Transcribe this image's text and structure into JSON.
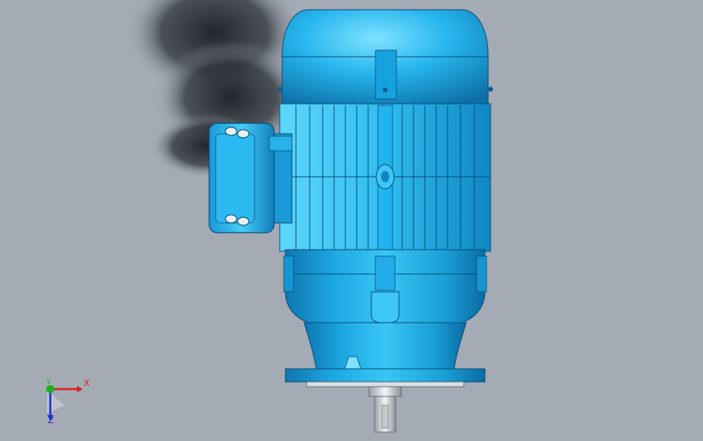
{
  "viewport": {
    "background": "#a4abb5",
    "model_color": "#1aa7e0",
    "model_highlight": "#6fdcff",
    "model_shadow": "#0c6fa6"
  },
  "triad": {
    "x_label": "X",
    "y_label": "Y",
    "z_label": "Z",
    "x_color": "#e02020",
    "y_color": "#20b020",
    "z_color": "#2030d0"
  }
}
